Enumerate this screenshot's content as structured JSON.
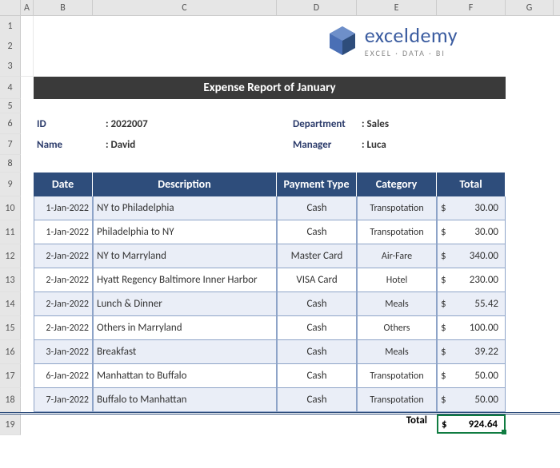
{
  "columns": [
    "A",
    "B",
    "C",
    "D",
    "E",
    "F",
    "G"
  ],
  "rows": [
    "1",
    "2",
    "3",
    "4",
    "5",
    "6",
    "7",
    "8",
    "9",
    "10",
    "11",
    "12",
    "13",
    "14",
    "15",
    "16",
    "17",
    "18",
    "19"
  ],
  "logo": {
    "brand": "exceldemy",
    "tagline": "EXCEL · DATA · BI"
  },
  "title": "Expense Report of January",
  "meta": {
    "id_label": "ID",
    "id_value": "2022007",
    "name_label": "Name",
    "name_value": "David",
    "dept_label": "Department",
    "dept_value": "Sales",
    "mgr_label": "Manager",
    "mgr_value": "Luca"
  },
  "headers": {
    "date": "Date",
    "desc": "Description",
    "ptype": "Payment Type",
    "cat": "Category",
    "total": "Total"
  },
  "rows_data": [
    {
      "date": "1-Jan-2022",
      "desc": "NY to Philadelphia",
      "ptype": "Cash",
      "cat": "Transpotation",
      "amt": "30.00"
    },
    {
      "date": "1-Jan-2022",
      "desc": "Philadelphia to NY",
      "ptype": "Cash",
      "cat": "Transpotation",
      "amt": "30.00"
    },
    {
      "date": "2-Jan-2022",
      "desc": "NY to Marryland",
      "ptype": "Master Card",
      "cat": "Air-Fare",
      "amt": "340.00"
    },
    {
      "date": "2-Jan-2022",
      "desc": "Hyatt Regency Baltimore Inner Harbor",
      "ptype": "VISA Card",
      "cat": "Hotel",
      "amt": "230.00"
    },
    {
      "date": "2-Jan-2022",
      "desc": "Lunch & Dinner",
      "ptype": "Cash",
      "cat": "Meals",
      "amt": "55.42"
    },
    {
      "date": "2-Jan-2022",
      "desc": "Others in Marryland",
      "ptype": "Cash",
      "cat": "Others",
      "amt": "100.00"
    },
    {
      "date": "3-Jan-2022",
      "desc": "Breakfast",
      "ptype": "Cash",
      "cat": "Meals",
      "amt": "39.22"
    },
    {
      "date": "6-Jan-2022",
      "desc": "Manhattan to Buffalo",
      "ptype": "Cash",
      "cat": "Transpotation",
      "amt": "50.00"
    },
    {
      "date": "7-Jan-2022",
      "desc": "Buffalo to Manhattan",
      "ptype": "Cash",
      "cat": "Transpotation",
      "amt": "50.00"
    }
  ],
  "total": {
    "label": "Total",
    "value": "924.64"
  },
  "currency": "$"
}
